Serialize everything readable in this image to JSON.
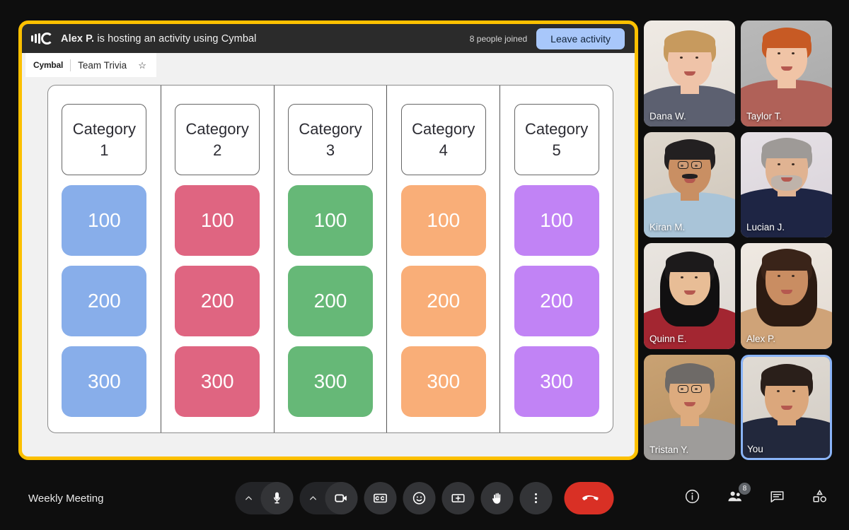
{
  "activity": {
    "logo_icon": "cymbal-logo-icon",
    "host_name": "Alex P.",
    "host_text_rest": "is hosting an activity using Cymbal",
    "joined_count_label": "8 people joined",
    "leave_button_label": "Leave activity",
    "breadcrumb": {
      "brand": "Cymbal",
      "title": "Team Trivia",
      "star_icon": "☆"
    }
  },
  "board": {
    "columns": [
      {
        "category_word": "Category",
        "category_number": "1",
        "color": "#88aeea",
        "tiles": [
          "100",
          "200",
          "300"
        ]
      },
      {
        "category_word": "Category",
        "category_number": "2",
        "color": "#df6581",
        "tiles": [
          "100",
          "200",
          "300"
        ]
      },
      {
        "category_word": "Category",
        "category_number": "3",
        "color": "#66b877",
        "tiles": [
          "100",
          "200",
          "300"
        ]
      },
      {
        "category_word": "Category",
        "category_number": "4",
        "color": "#f9ae78",
        "tiles": [
          "100",
          "200",
          "300"
        ]
      },
      {
        "category_word": "Category",
        "category_number": "5",
        "color": "#c183f5",
        "tiles": [
          "100",
          "200",
          "300"
        ]
      }
    ]
  },
  "participants": [
    {
      "name": "Dana W.",
      "self": false
    },
    {
      "name": "Taylor T.",
      "self": false
    },
    {
      "name": "Kiran M.",
      "self": false
    },
    {
      "name": "Lucian J.",
      "self": false
    },
    {
      "name": "Quinn E.",
      "self": false
    },
    {
      "name": "Alex P.",
      "self": false
    },
    {
      "name": "Tristan Y.",
      "self": false
    },
    {
      "name": "You",
      "self": true
    }
  ],
  "bottom_bar": {
    "meeting_name": "Weekly Meeting",
    "controls": [
      {
        "name": "microphone-button",
        "icon": "mic-icon",
        "has_chevron": true
      },
      {
        "name": "camera-button",
        "icon": "video-camera-icon",
        "has_chevron": true
      },
      {
        "name": "captions-button",
        "icon": "closed-captions-icon",
        "has_chevron": false
      },
      {
        "name": "reactions-button",
        "icon": "emoji-smile-icon",
        "has_chevron": false
      },
      {
        "name": "present-button",
        "icon": "present-screen-icon",
        "has_chevron": false
      },
      {
        "name": "raise-hand-button",
        "icon": "raised-hand-icon",
        "has_chevron": false
      },
      {
        "name": "more-options-button",
        "icon": "three-dots-vertical-icon",
        "has_chevron": false
      }
    ],
    "end_call": {
      "name": "end-call-button",
      "icon": "phone-hangup-icon"
    },
    "right_controls": [
      {
        "name": "meeting-details-button",
        "icon": "info-circle-icon",
        "badge": null
      },
      {
        "name": "people-panel-button",
        "icon": "people-icon",
        "badge": "8"
      },
      {
        "name": "chat-panel-button",
        "icon": "chat-bubble-icon",
        "badge": null
      },
      {
        "name": "activities-panel-button",
        "icon": "activities-shapes-icon",
        "badge": null
      }
    ]
  },
  "colors": {
    "accent_yellow": "#fcc000",
    "leave_button_bg": "#a8c7fa",
    "end_call_red": "#d93025",
    "self_highlight": "#8ab4f8"
  }
}
